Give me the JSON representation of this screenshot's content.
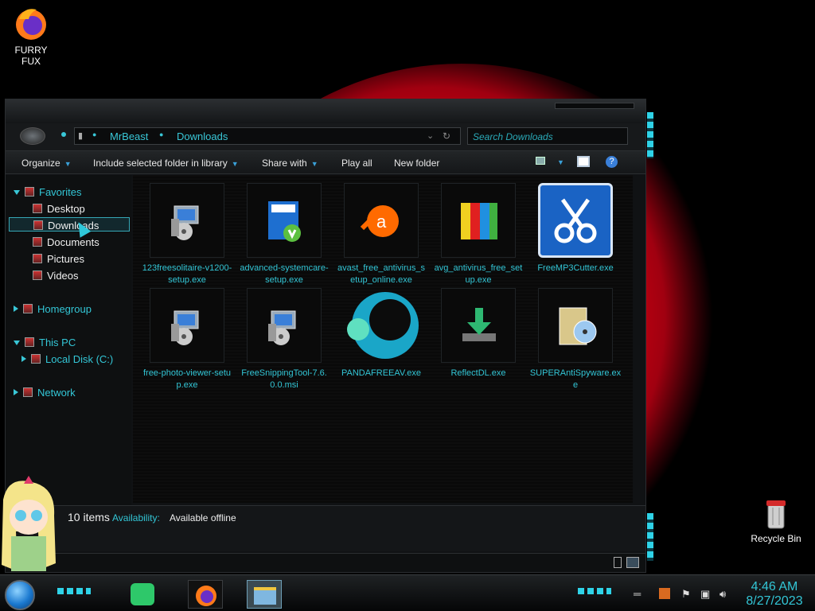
{
  "desktop": {
    "icons": [
      {
        "label": "FURRY FUX"
      },
      {
        "label": "Recycle Bin"
      }
    ]
  },
  "window": {
    "address": {
      "segments": [
        "MrBeast",
        "Downloads"
      ],
      "search_placeholder": "Search Downloads"
    },
    "toolbar": {
      "organize": "Organize",
      "include": "Include selected folder in library",
      "share": "Share with",
      "play_all": "Play all",
      "new_folder": "New folder"
    },
    "nav": {
      "favorites": "Favorites",
      "desktop": "Desktop",
      "downloads": "Downloads",
      "documents": "Documents",
      "pictures": "Pictures",
      "videos": "Videos",
      "homegroup": "Homegroup",
      "this_pc": "This PC",
      "local_disk": "Local Disk (C:)",
      "network": "Network"
    },
    "files": [
      {
        "name": "123freesolitaire-v1200-setup.exe",
        "icon": "installer-icon"
      },
      {
        "name": "advanced-systemcare-setup.exe",
        "icon": "iobit-icon"
      },
      {
        "name": "avast_free_antivirus_setup_online.exe",
        "icon": "avast-icon"
      },
      {
        "name": "avg_antivirus_free_setup.exe",
        "icon": "avg-icon"
      },
      {
        "name": "FreeMP3Cutter.exe",
        "icon": "scissors-icon"
      },
      {
        "name": "free-photo-viewer-setup.exe",
        "icon": "installer-icon"
      },
      {
        "name": "FreeSnippingTool-7.6.0.0.msi",
        "icon": "installer-icon"
      },
      {
        "name": "PANDAFREEAV.exe",
        "icon": "panda-icon"
      },
      {
        "name": "ReflectDL.exe",
        "icon": "download-icon"
      },
      {
        "name": "SUPERAntiSpyware.exe",
        "icon": "cd-box-icon"
      }
    ],
    "details": {
      "count": "10 items",
      "availability_label": "Availability:",
      "availability_value": "Available offline"
    }
  },
  "taskbar": {
    "time": "4:46 AM",
    "date": "8/27/2023"
  },
  "colors": {
    "accent": "#33c6d6",
    "wallpaper_red": "#e00010",
    "selection": "#1a63c4"
  }
}
